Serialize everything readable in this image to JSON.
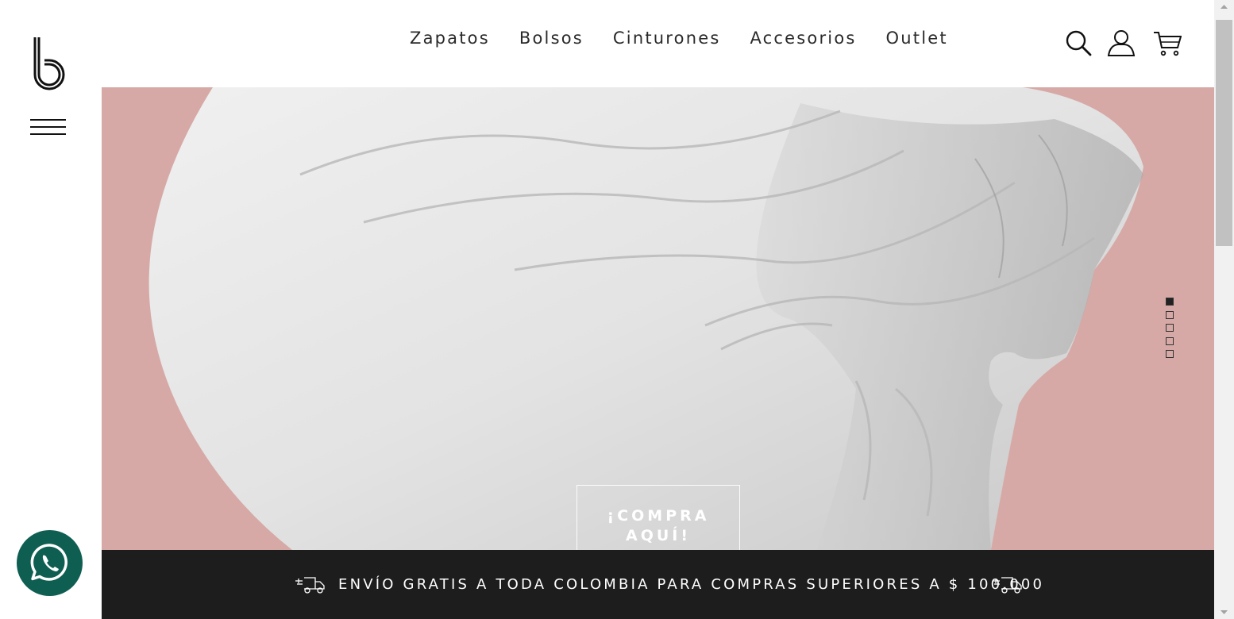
{
  "nav": {
    "links": [
      "Zapatos",
      "Bolsos",
      "Cinturones",
      "Accesorios",
      "Outlet"
    ]
  },
  "hero": {
    "cta_label": "¡COMPRA AQUÍ!",
    "slides": 5,
    "active_slide": 1,
    "background_color": "#d6a9a6"
  },
  "banner": {
    "text": "ENVÍO GRATIS A TODA COLOMBIA PARA COMPRAS SUPERIORES A $ 100.000"
  },
  "icons": {
    "logo": "brand-b-logo",
    "menu": "hamburger-icon",
    "search": "search-icon",
    "account": "user-icon",
    "cart": "cart-icon",
    "truck": "truck-icon",
    "whatsapp": "whatsapp-icon"
  },
  "colors": {
    "banner_bg": "#1d1d1d",
    "whatsapp_bg": "#0f5e52"
  }
}
